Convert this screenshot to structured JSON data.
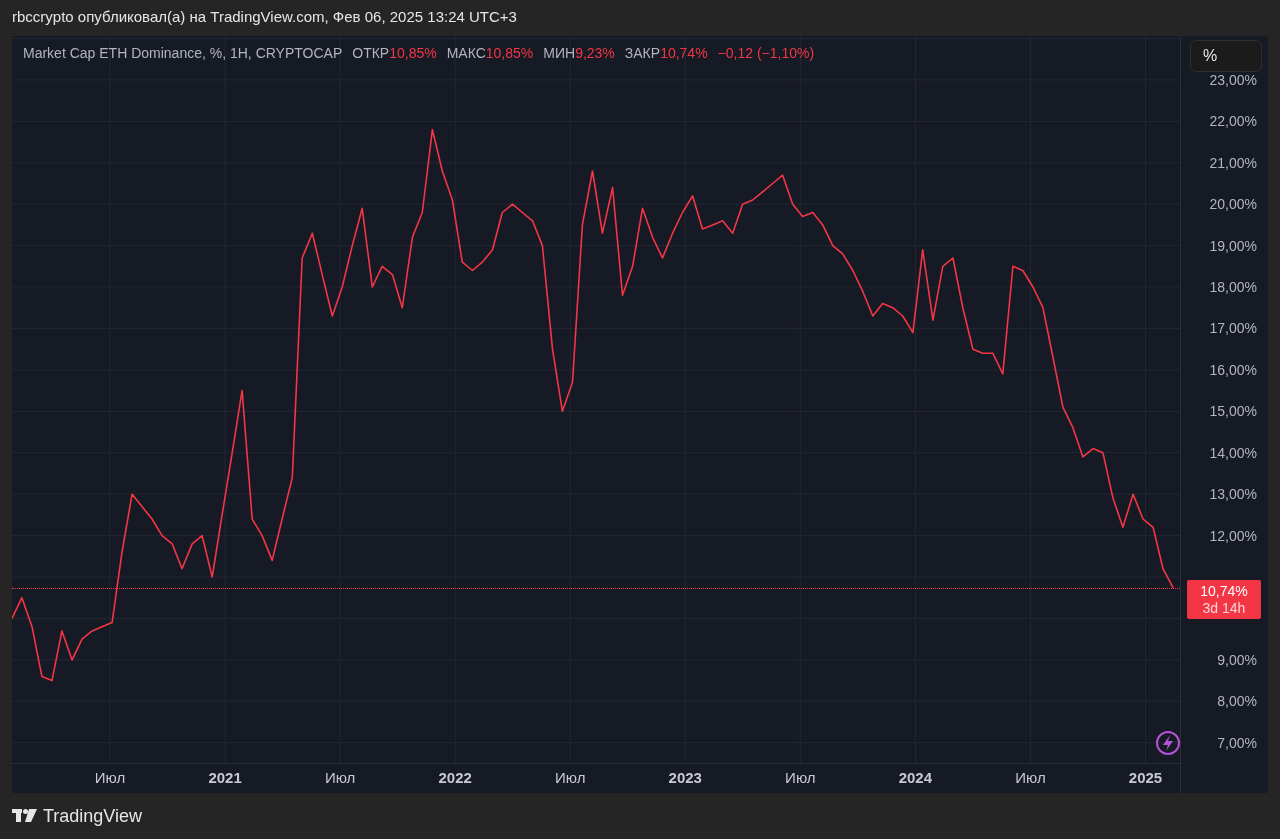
{
  "header": {
    "text": "rbccrypto опубликовал(а) на TradingView.com, Фев 06, 2025 13:24 UTC+3"
  },
  "chart": {
    "legend": {
      "title": "Market Cap ETH Dominance, %, 1H, CRYPTOCAP",
      "stats": [
        {
          "label": "ОТКР",
          "value": "10,85%"
        },
        {
          "label": "МАКС",
          "value": "10,85%"
        },
        {
          "label": "МИН",
          "value": "9,23%"
        },
        {
          "label": "ЗАКР",
          "value": "10,74%"
        }
      ],
      "change": "−0,12 (−1,10%)"
    },
    "scale_button": "%",
    "price_label": {
      "price": "10,74%",
      "countdown": "3d 14h"
    },
    "chart_data": {
      "type": "line",
      "xlim": [
        2020.074,
        2025.15
      ],
      "ylim": [
        6.51,
        24.06
      ],
      "grid": true,
      "x": [
        2020.074,
        2020.117,
        2020.161,
        2020.204,
        2020.248,
        2020.291,
        2020.335,
        2020.378,
        2020.422,
        2020.465,
        2020.509,
        2020.552,
        2020.596,
        2020.639,
        2020.683,
        2020.726,
        2020.77,
        2020.813,
        2020.857,
        2020.9,
        2020.944,
        2020.987,
        2021.031,
        2021.074,
        2021.118,
        2021.161,
        2021.205,
        2021.248,
        2021.292,
        2021.335,
        2021.379,
        2021.422,
        2021.466,
        2021.509,
        2021.553,
        2021.596,
        2021.64,
        2021.683,
        2021.727,
        2021.77,
        2021.814,
        2021.857,
        2021.901,
        2021.944,
        2021.988,
        2022.031,
        2022.075,
        2022.118,
        2022.162,
        2022.205,
        2022.249,
        2022.292,
        2022.336,
        2022.379,
        2022.423,
        2022.466,
        2022.51,
        2022.553,
        2022.597,
        2022.64,
        2022.684,
        2022.727,
        2022.771,
        2022.814,
        2022.858,
        2022.901,
        2022.945,
        2022.988,
        2023.032,
        2023.075,
        2023.119,
        2023.162,
        2023.206,
        2023.249,
        2023.293,
        2023.336,
        2023.38,
        2023.423,
        2023.467,
        2023.51,
        2023.554,
        2023.597,
        2023.641,
        2023.684,
        2023.728,
        2023.771,
        2023.815,
        2023.858,
        2023.902,
        2023.945,
        2023.989,
        2024.032,
        2024.076,
        2024.119,
        2024.163,
        2024.206,
        2024.25,
        2024.293,
        2024.337,
        2024.38,
        2024.424,
        2024.467,
        2024.511,
        2024.554,
        2024.598,
        2024.641,
        2024.685,
        2024.728,
        2024.772,
        2024.815,
        2024.859,
        2024.902,
        2024.946,
        2024.989,
        2025.033,
        2025.076,
        2025.12
      ],
      "series": [
        {
          "color": "#f23645",
          "values": [
            10.0,
            10.5,
            9.8,
            8.6,
            8.5,
            9.7,
            9.0,
            9.5,
            9.7,
            9.8,
            9.9,
            11.6,
            13.0,
            12.7,
            12.4,
            12.0,
            11.8,
            11.2,
            11.8,
            12.0,
            11.0,
            12.5,
            14.0,
            15.5,
            12.4,
            12.0,
            11.4,
            12.4,
            13.4,
            18.7,
            19.3,
            18.3,
            17.3,
            18.0,
            19.0,
            19.9,
            18.0,
            18.5,
            18.3,
            17.5,
            19.2,
            19.8,
            21.8,
            20.8,
            20.1,
            18.6,
            18.4,
            18.6,
            18.9,
            19.8,
            20.0,
            19.8,
            19.6,
            19.0,
            16.5,
            15.0,
            15.7,
            19.5,
            20.8,
            19.3,
            20.4,
            17.8,
            18.5,
            19.9,
            19.2,
            18.7,
            19.3,
            19.8,
            20.2,
            19.4,
            19.5,
            19.6,
            19.3,
            20.0,
            20.1,
            20.3,
            20.5,
            20.7,
            20.0,
            19.7,
            19.8,
            19.5,
            19.0,
            18.8,
            18.4,
            17.9,
            17.3,
            17.6,
            17.5,
            17.3,
            16.9,
            18.9,
            17.2,
            18.5,
            18.7,
            17.5,
            16.5,
            16.4,
            16.4,
            15.9,
            18.5,
            18.4,
            18.0,
            17.5,
            16.3,
            15.1,
            14.6,
            13.9,
            14.1,
            14.0,
            12.9,
            12.2,
            13.0,
            12.4,
            12.2,
            11.2,
            10.74
          ]
        }
      ],
      "xticks": [
        {
          "value": 2020.5,
          "label": "Июл"
        },
        {
          "value": 2021,
          "label": "2021"
        },
        {
          "value": 2021.5,
          "label": "Июл"
        },
        {
          "value": 2022,
          "label": "2022"
        },
        {
          "value": 2022.5,
          "label": "Июл"
        },
        {
          "value": 2023,
          "label": "2023"
        },
        {
          "value": 2023.5,
          "label": "Июл"
        },
        {
          "value": 2024,
          "label": "2024"
        },
        {
          "value": 2024.5,
          "label": "Июл"
        },
        {
          "value": 2025,
          "label": "2025"
        }
      ],
      "yticks": [
        {
          "value": 7,
          "label": "7,00%"
        },
        {
          "value": 8,
          "label": "8,00%"
        },
        {
          "value": 9,
          "label": "9,00%"
        },
        {
          "value": 12,
          "label": "12,00%"
        },
        {
          "value": 13,
          "label": "13,00%"
        },
        {
          "value": 14,
          "label": "14,00%"
        },
        {
          "value": 15,
          "label": "15,00%"
        },
        {
          "value": 16,
          "label": "16,00%"
        },
        {
          "value": 17,
          "label": "17,00%"
        },
        {
          "value": 18,
          "label": "18,00%"
        },
        {
          "value": 19,
          "label": "19,00%"
        },
        {
          "value": 20,
          "label": "20,00%"
        },
        {
          "value": 21,
          "label": "21,00%"
        },
        {
          "value": 22,
          "label": "22,00%"
        },
        {
          "value": 23,
          "label": "23,00%"
        }
      ]
    }
  },
  "footer": {
    "brand": "TradingView"
  }
}
